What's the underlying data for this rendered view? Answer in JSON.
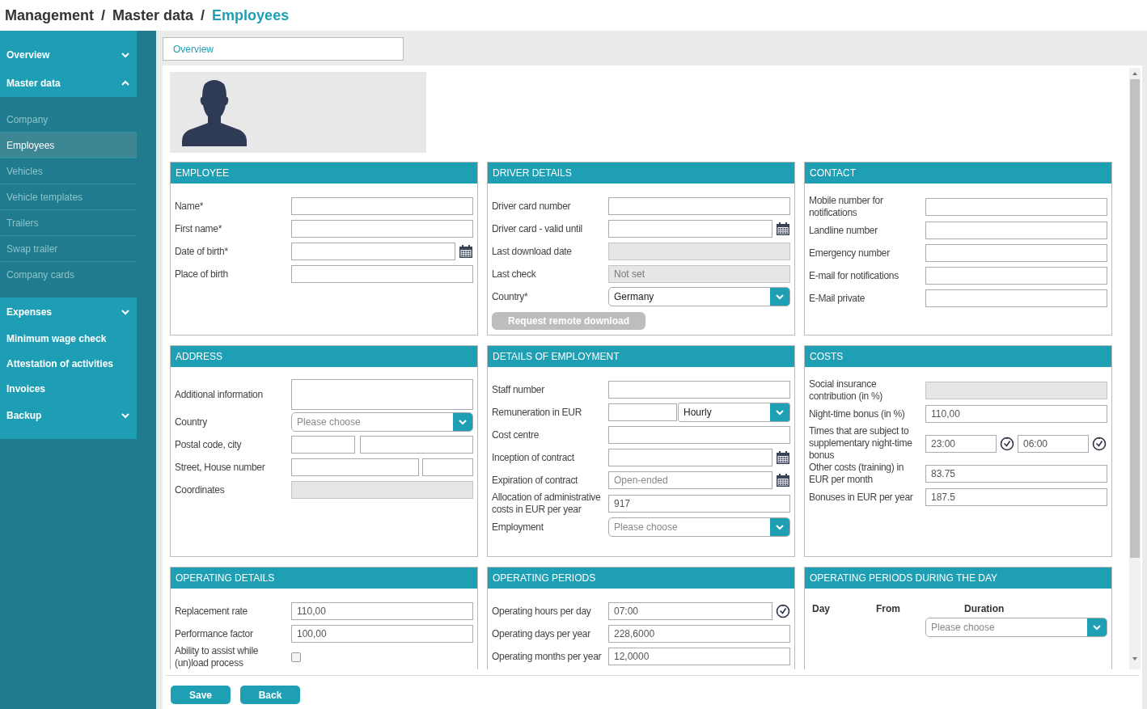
{
  "breadcrumb": [
    {
      "label": "Management",
      "kind": "link"
    },
    {
      "label": "/",
      "kind": "separator"
    },
    {
      "label": "Master data",
      "kind": "link"
    },
    {
      "label": "/",
      "kind": "separator"
    },
    {
      "label": "Employees",
      "kind": "current"
    }
  ],
  "sidebar": [
    {
      "label": "Overview",
      "kind": "group",
      "expanded": false
    },
    {
      "label": "Master data",
      "kind": "group",
      "expanded": true,
      "children": [
        {
          "label": "Company",
          "selected": false
        },
        {
          "label": "Employees",
          "selected": true
        },
        {
          "label": "Vehicles",
          "selected": false
        },
        {
          "label": "Vehicle templates",
          "selected": false
        },
        {
          "label": "Trailers",
          "selected": false
        },
        {
          "label": "Swap trailer",
          "selected": false
        },
        {
          "label": "Company cards",
          "selected": false
        }
      ]
    },
    {
      "label": "Expenses",
      "kind": "group",
      "expanded": false
    },
    {
      "label": "Minimum wage check",
      "kind": "link"
    },
    {
      "label": "Attestation of activities",
      "kind": "link"
    },
    {
      "label": "Invoices",
      "kind": "link"
    },
    {
      "label": "Backup",
      "kind": "group",
      "expanded": false
    }
  ],
  "tabs": [
    {
      "label": "Overview",
      "selected": true
    }
  ],
  "panels": [
    {
      "title": "EMPLOYEE",
      "kind": "form",
      "rows": [
        {
          "label": "Name*",
          "kind": "text",
          "disabled": false
        },
        {
          "label": "First name*",
          "kind": "text",
          "disabled": false
        },
        {
          "label": "Date of birth*",
          "kind": "date"
        },
        {
          "label": "Place of birth",
          "kind": "text",
          "disabled": false
        }
      ]
    },
    {
      "title": "DRIVER DETAILS",
      "kind": "form",
      "rows": [
        {
          "label": "Driver card number",
          "kind": "text",
          "disabled": false
        },
        {
          "label": "Driver card - valid until",
          "kind": "date"
        },
        {
          "label": "Last download date",
          "kind": "text",
          "disabled": true
        },
        {
          "label": "Last check",
          "kind": "text",
          "disabled": true,
          "value": "Not set"
        },
        {
          "label": "Country*",
          "kind": "select",
          "value": "Germany"
        }
      ],
      "button": {
        "label": "Request remote download",
        "disabled": true
      }
    },
    {
      "title": "CONTACT",
      "kind": "form",
      "rows": [
        {
          "label": "Mobile number for notifications",
          "kind": "text",
          "disabled": false
        },
        {
          "label": "Landline number",
          "kind": "text",
          "disabled": false
        },
        {
          "label": "Emergency number",
          "kind": "text",
          "disabled": false
        },
        {
          "label": "E-mail for notifications",
          "kind": "text",
          "disabled": false
        },
        {
          "label": "E-Mail private",
          "kind": "text",
          "disabled": false
        }
      ]
    },
    {
      "title": "ADDRESS",
      "kind": "form",
      "rows": [
        {
          "label": "Additional information",
          "kind": "textarea"
        },
        {
          "label": "Country",
          "kind": "select",
          "placeholder": "Please choose"
        },
        {
          "label": "Postal code, city",
          "kind": "postcode"
        },
        {
          "label": "Street, House number",
          "kind": "street"
        },
        {
          "label": "Coordinates",
          "kind": "text",
          "disabled": true
        }
      ]
    },
    {
      "title": "DETAILS OF EMPLOYMENT",
      "kind": "form",
      "rows": [
        {
          "label": "Staff number",
          "kind": "text",
          "disabled": false
        },
        {
          "label": "Remuneration in EUR",
          "kind": "amount",
          "unit": "Hourly"
        },
        {
          "label": "Cost centre",
          "kind": "text",
          "disabled": false
        },
        {
          "label": "Inception of contract",
          "kind": "date"
        },
        {
          "label": "Expiration of contract",
          "kind": "date",
          "placeholder": "Open-ended"
        },
        {
          "label": "Allocation of administrative costs in EUR per year",
          "kind": "text",
          "disabled": false,
          "value": "917"
        },
        {
          "label": "Employment",
          "kind": "select",
          "placeholder": "Please choose"
        }
      ]
    },
    {
      "title": "COSTS",
      "kind": "form",
      "rows": [
        {
          "label": "Social insurance contribution (in %)",
          "kind": "text",
          "disabled": true
        },
        {
          "label": "Night-time bonus (in %)",
          "kind": "text",
          "disabled": false,
          "value": "110,00"
        },
        {
          "label": "Times that are subject to supplementary night-time bonus",
          "kind": "timerange",
          "values": [
            "23:00",
            "06:00"
          ]
        },
        {
          "label": "Other costs (training) in EUR per month",
          "kind": "text",
          "disabled": false,
          "value": "83.75"
        },
        {
          "label": "Bonuses in EUR per year",
          "kind": "text",
          "disabled": false,
          "value": "187.5"
        }
      ]
    },
    {
      "title": "OPERATING DETAILS",
      "kind": "form",
      "rows": [
        {
          "label": "Replacement rate",
          "kind": "text",
          "disabled": false,
          "value": "110,00"
        },
        {
          "label": "Performance factor",
          "kind": "text",
          "disabled": false,
          "value": "100,00"
        },
        {
          "label": "Ability to assist while (un)load process",
          "kind": "checkbox",
          "checked": false
        }
      ]
    },
    {
      "title": "OPERATING PERIODS",
      "kind": "form",
      "rows": [
        {
          "label": "Operating hours per day",
          "kind": "time",
          "value": "07:00"
        },
        {
          "label": "Operating days per year",
          "kind": "text",
          "disabled": false,
          "value": "228,6000"
        },
        {
          "label": "Operating months per year",
          "kind": "text",
          "disabled": false,
          "value": "12,0000"
        }
      ]
    },
    {
      "title": "OPERATING PERIODS DURING THE DAY",
      "kind": "schedule",
      "columns": [
        "Day",
        "From",
        "Duration"
      ],
      "duration": {
        "placeholder": "Please choose"
      }
    }
  ],
  "buttons": [
    "Save",
    "Back"
  ]
}
